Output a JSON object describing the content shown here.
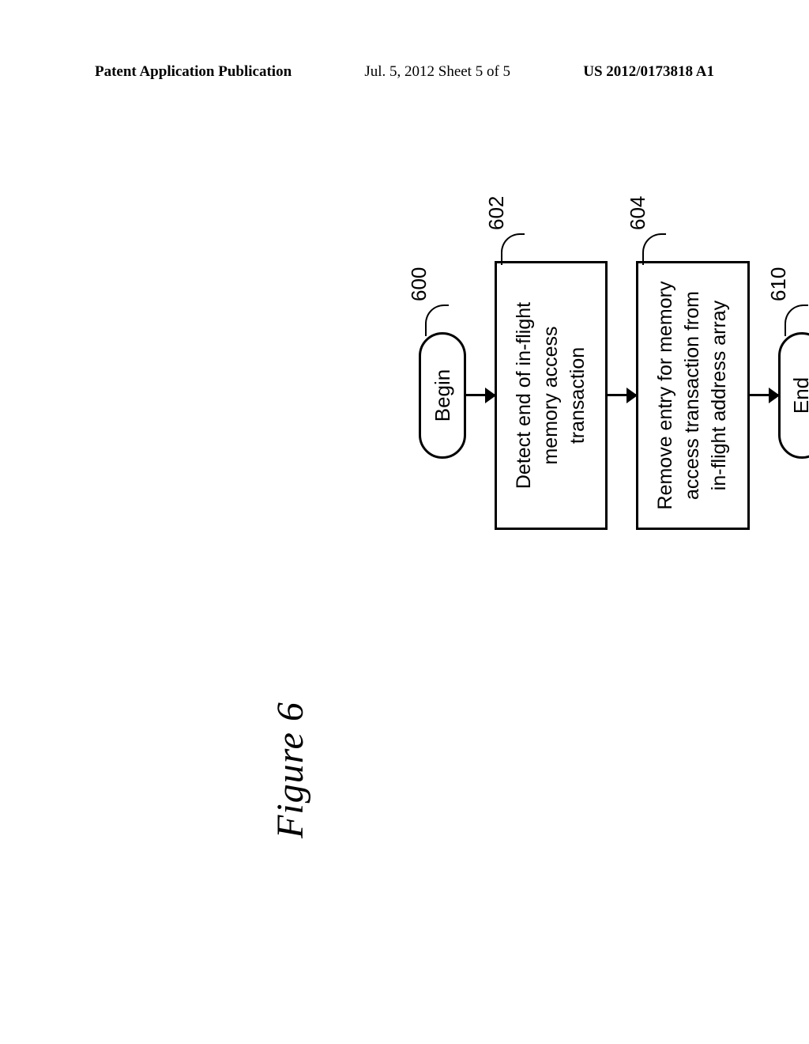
{
  "header": {
    "left": "Patent Application Publication",
    "center": "Jul. 5, 2012   Sheet 5 of 5",
    "right": "US 2012/0173818 A1"
  },
  "figure_label": "Figure 6",
  "flowchart": {
    "begin": {
      "label": "Begin",
      "ref": "600"
    },
    "step1": {
      "label": "Detect end of in-flight memory access transaction",
      "ref": "602"
    },
    "step2": {
      "label": "Remove entry for memory access transaction from in-flight address array",
      "ref": "604"
    },
    "end": {
      "label": "End",
      "ref": "610"
    }
  }
}
